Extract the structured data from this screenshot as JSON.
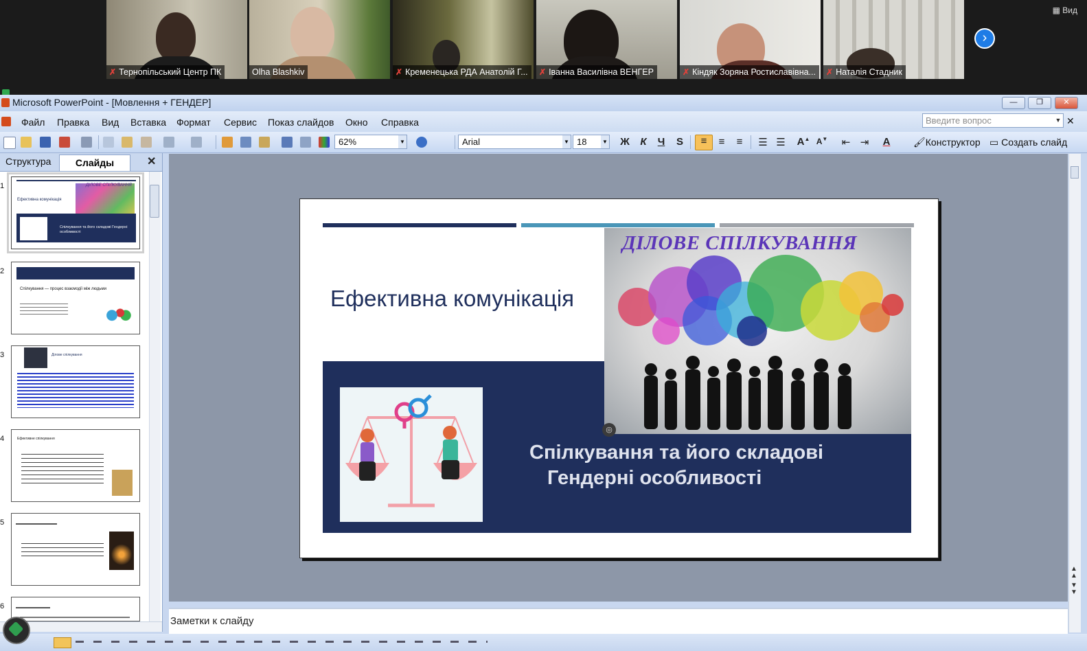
{
  "meeting": {
    "participants": [
      {
        "name": "Тернопільський Центр ПК",
        "muted": true
      },
      {
        "name": "Olha Blashkiv",
        "muted": false
      },
      {
        "name": "Кременецька РДА Анатолій Г...",
        "muted": true
      },
      {
        "name": "Іванна Василівна ВЕНГЕР",
        "muted": true
      },
      {
        "name": "Кіндяк Зоряна Ростиславівна...",
        "muted": true
      },
      {
        "name": "Наталія Стадник",
        "muted": true
      }
    ],
    "view_label": "Вид",
    "next_icon": "chevron-right-icon"
  },
  "window": {
    "title": "Microsoft PowerPoint - [Мовлення + ГЕНДЕР]",
    "controls": [
      "—",
      "❐",
      "✕"
    ]
  },
  "menu": {
    "items": [
      "Файл",
      "Правка",
      "Вид",
      "Вставка",
      "Формат",
      "Сервис",
      "Показ слайдов",
      "Окно",
      "Справка"
    ],
    "ask_placeholder": "Введите вопрос"
  },
  "toolbar": {
    "zoom": "62%",
    "font": "Arial",
    "font_size": "18",
    "bold": "Ж",
    "italic": "К",
    "underline": "Ч",
    "shadow": "S",
    "design_label": "Конструктор",
    "new_slide_label": "Создать слайд"
  },
  "pane": {
    "tab_outline": "Структура",
    "tab_slides": "Слайды",
    "slides": [
      {
        "num": "1",
        "title": "Ефективна комунікація",
        "subtitle": "Спілкування та його складові Гендерні особливості",
        "header": "ДІЛОВЕ СПІЛКУВАННЯ"
      },
      {
        "num": "2",
        "title": "Спілкування — процес взаємодії між людьми"
      },
      {
        "num": "3",
        "title": "Ділове спілкування"
      },
      {
        "num": "4",
        "title": "Ефективне спілкування"
      },
      {
        "num": "5",
        "title": ""
      },
      {
        "num": "6",
        "title": ""
      }
    ]
  },
  "slide": {
    "title": "Ефективна комунікація",
    "image_caption": "ДІЛОВЕ СПІЛКУВАННЯ",
    "subtitle_line1": "Спілкування та його складові",
    "subtitle_line2": "Гендерні особливості",
    "colors": {
      "navy": "#1f2f5c",
      "teal": "#4a96b8",
      "gray": "#a0a4aa"
    }
  },
  "notes": {
    "placeholder": "Заметки к слайду"
  }
}
